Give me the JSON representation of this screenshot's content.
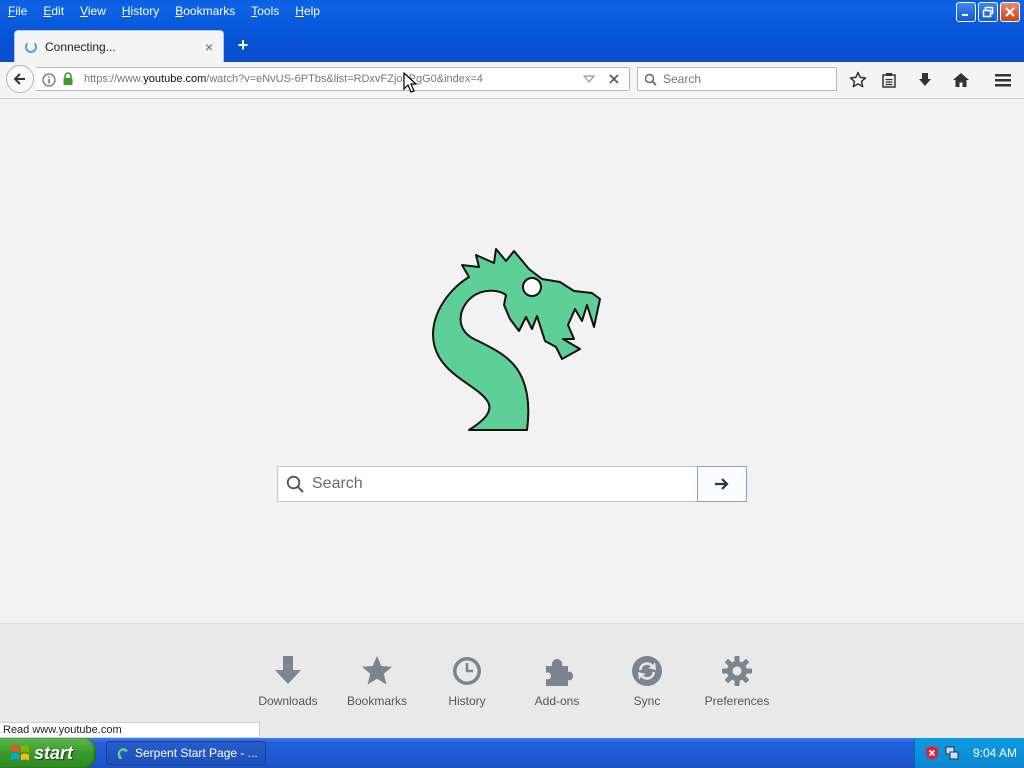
{
  "menubar": {
    "items": [
      "File",
      "Edit",
      "View",
      "History",
      "Bookmarks",
      "Tools",
      "Help"
    ]
  },
  "tab": {
    "title": "Connecting...",
    "close": "×"
  },
  "new_tab": "+",
  "urlbar": {
    "prefix": "https://www.",
    "host": "youtube.com",
    "path": "/watch?v=eNvUS-6PTbs&list=RDxvFZjo5PgG0&index=4"
  },
  "searchbar": {
    "placeholder": "Search"
  },
  "page": {
    "search_placeholder": "Search"
  },
  "launcher": {
    "items": [
      {
        "label": "Downloads",
        "icon": "download-icon"
      },
      {
        "label": "Bookmarks",
        "icon": "star-icon"
      },
      {
        "label": "History",
        "icon": "clock-icon"
      },
      {
        "label": "Add-ons",
        "icon": "puzzle-icon"
      },
      {
        "label": "Sync",
        "icon": "sync-icon"
      },
      {
        "label": "Preferences",
        "icon": "gear-icon"
      }
    ]
  },
  "status": "Read www.youtube.com",
  "taskbar": {
    "start": "start",
    "task": "Serpent Start Page - ...",
    "clock": "9:04 AM"
  },
  "colors": {
    "logo_fill": "#5ecf96",
    "xp_blue": "#0a5fe0",
    "taskbar_blue": "#245edb"
  }
}
